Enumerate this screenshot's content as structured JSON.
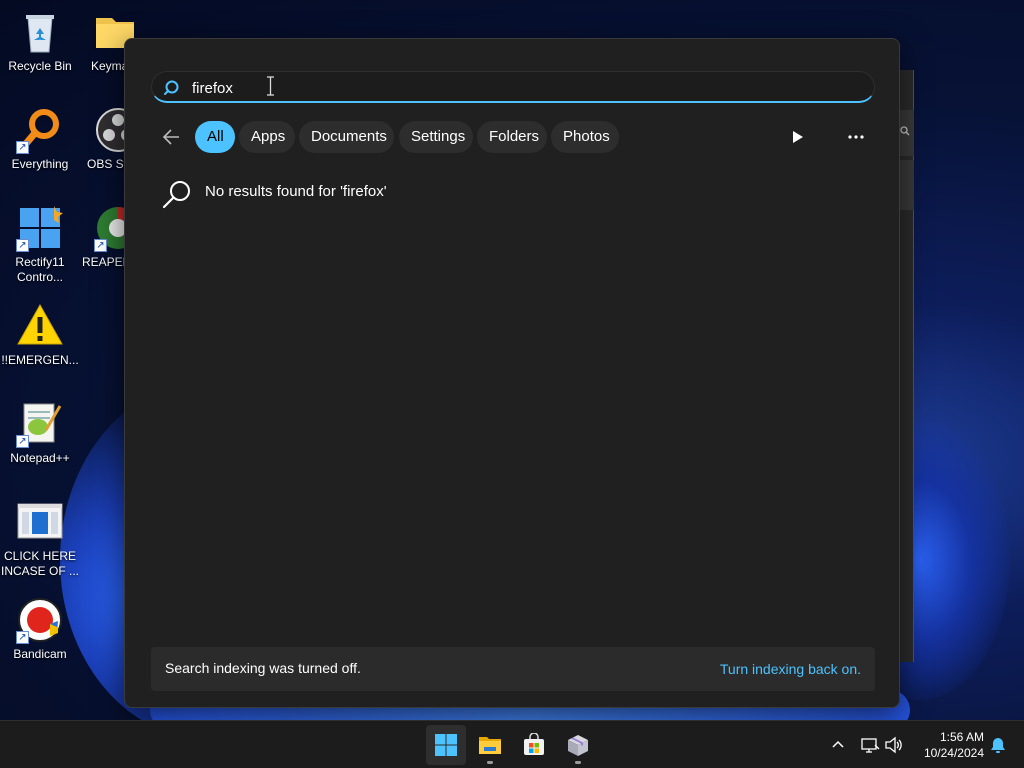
{
  "desktop": {
    "icons": [
      {
        "label": "Recycle Bin",
        "icon": "recycle-bin-icon"
      },
      {
        "label": "Keyma",
        "icon": "folder-icon"
      },
      {
        "label": "Everything",
        "icon": "everything-magnifier-icon"
      },
      {
        "label": "OBS Stu",
        "icon": "obs-studio-icon"
      },
      {
        "label": "Rectify11 Contro...",
        "icon": "rectify11-icon"
      },
      {
        "label": "REAPER",
        "icon": "reaper-icon"
      },
      {
        "label": "!!EMERGEN...",
        "icon": "warning-icon"
      },
      {
        "label": "Notepad++",
        "icon": "notepad-plus-plus-icon"
      },
      {
        "label": "CLICK HERE INCASE OF ...",
        "icon": "document-icon"
      },
      {
        "label": "Bandicam",
        "icon": "bandicam-icon"
      }
    ]
  },
  "search": {
    "query": "firefox",
    "filters": [
      "All",
      "Apps",
      "Documents",
      "Settings",
      "Folders",
      "Photos"
    ],
    "active_filter": "All",
    "no_results_text": "No results found for 'firefox'",
    "indexing_message": "Search indexing was turned off.",
    "indexing_link": "Turn indexing back on."
  },
  "taskbar": {
    "apps": [
      "start-icon",
      "file-explorer-icon",
      "microsoft-store-icon",
      "package-icon"
    ],
    "tray": [
      "chevron-up-icon",
      "network-icon",
      "volume-icon"
    ],
    "time": "1:56 AM",
    "date": "10/24/2024",
    "notification_icon": "bell-icon"
  },
  "colors": {
    "accent": "#4cc2ff",
    "panel_bg": "#202020",
    "taskbar_bg": "#1c1c1c"
  }
}
